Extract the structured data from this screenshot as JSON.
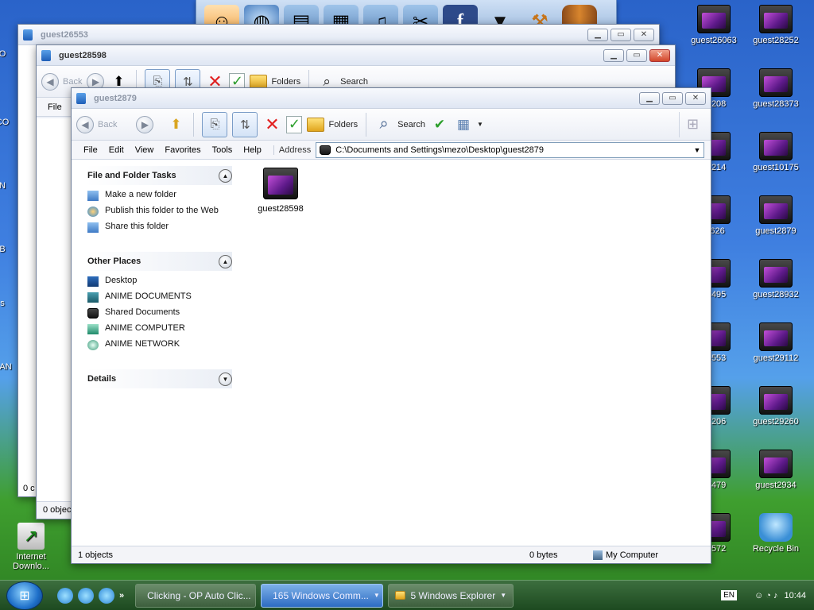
{
  "desktop": {
    "right_col1": [
      "guest26063",
      "26208",
      "26214",
      "t2626",
      "26495",
      "26553",
      "27206",
      "27479",
      "27572"
    ],
    "right_col2": [
      "guest28252",
      "guest28373",
      "guest10175",
      "guest2879",
      "guest28932",
      "guest29112",
      "guest29260",
      "guest2934",
      "Recycle Bin"
    ],
    "left_labels": [
      "DO",
      "CO",
      "N",
      "B",
      "s",
      "AN",
      "Internet\nDownlo..."
    ]
  },
  "dock": {
    "icons": [
      "naruto-avatar-icon",
      "globe-network-icon",
      "documents-folder-icon",
      "pictures-folder-icon",
      "music-folder-icon",
      "tools-folder-icon",
      "facebook-icon",
      "tshirt-icon",
      "hammer-icon",
      "barrel-icon"
    ]
  },
  "window_back2": {
    "title": "guest26553"
  },
  "window_back1": {
    "title": "guest28598",
    "back_label": "Back",
    "folders_label": "Folders",
    "search_label": "Search",
    "menu_file": "File",
    "status_left": "0 objec",
    "status_left_back": "0 c"
  },
  "window_main": {
    "title": "guest2879",
    "toolbar": {
      "back_label": "Back",
      "folders_label": "Folders",
      "search_label": "Search"
    },
    "menu": [
      "File",
      "Edit",
      "View",
      "Favorites",
      "Tools",
      "Help"
    ],
    "address_label": "Address",
    "address_value": "C:\\Documents and Settings\\mezo\\Desktop\\guest2879",
    "tasks": {
      "title": "File and Folder Tasks",
      "items": [
        "Make a new folder",
        "Publish this folder to the Web",
        "Share this folder"
      ]
    },
    "other_places": {
      "title": "Other Places",
      "items": [
        "Desktop",
        "ANIME DOCUMENTS",
        "Shared Documents",
        "ANIME COMPUTER",
        "ANIME NETWORK"
      ]
    },
    "details": {
      "title": "Details"
    },
    "files": [
      {
        "name": "guest28598"
      }
    ],
    "status": {
      "objects": "1 objects",
      "size": "0 bytes",
      "location": "My Computer"
    }
  },
  "taskbar": {
    "tasks": [
      {
        "label": "Clicking - OP Auto Clic...",
        "active": false
      },
      {
        "label": "165 Windows Comm...",
        "active": true
      },
      {
        "label": "5 Windows Explorer",
        "active": false
      }
    ],
    "lang": "EN",
    "time": "10:44",
    "chevron": "»"
  }
}
